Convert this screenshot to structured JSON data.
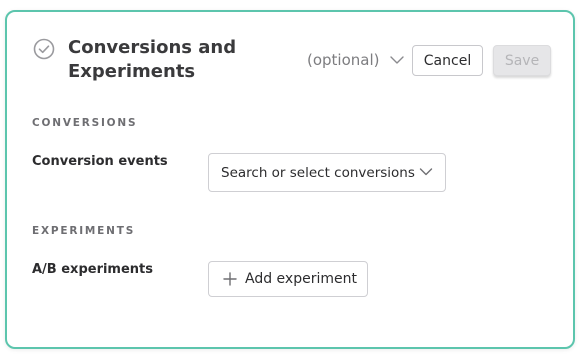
{
  "header": {
    "title": "Conversions and Experiments",
    "optional_label": "(optional)",
    "cancel_label": "Cancel",
    "save_label": "Save"
  },
  "conversions": {
    "section_title": "CONVERSIONS",
    "field_label": "Conversion events",
    "select_placeholder": "Search or select conversions"
  },
  "experiments": {
    "section_title": "EXPERIMENTS",
    "field_label": "A/B experiments",
    "add_label": "Add experiment"
  },
  "icons": {
    "status": "check-circle-icon",
    "optional_toggle": "chevron-down-icon",
    "select_toggle": "chevron-down-icon",
    "add": "plus-icon"
  },
  "colors": {
    "card_border": "#5cc5ad",
    "save_disabled_bg": "#e6e6e8"
  }
}
